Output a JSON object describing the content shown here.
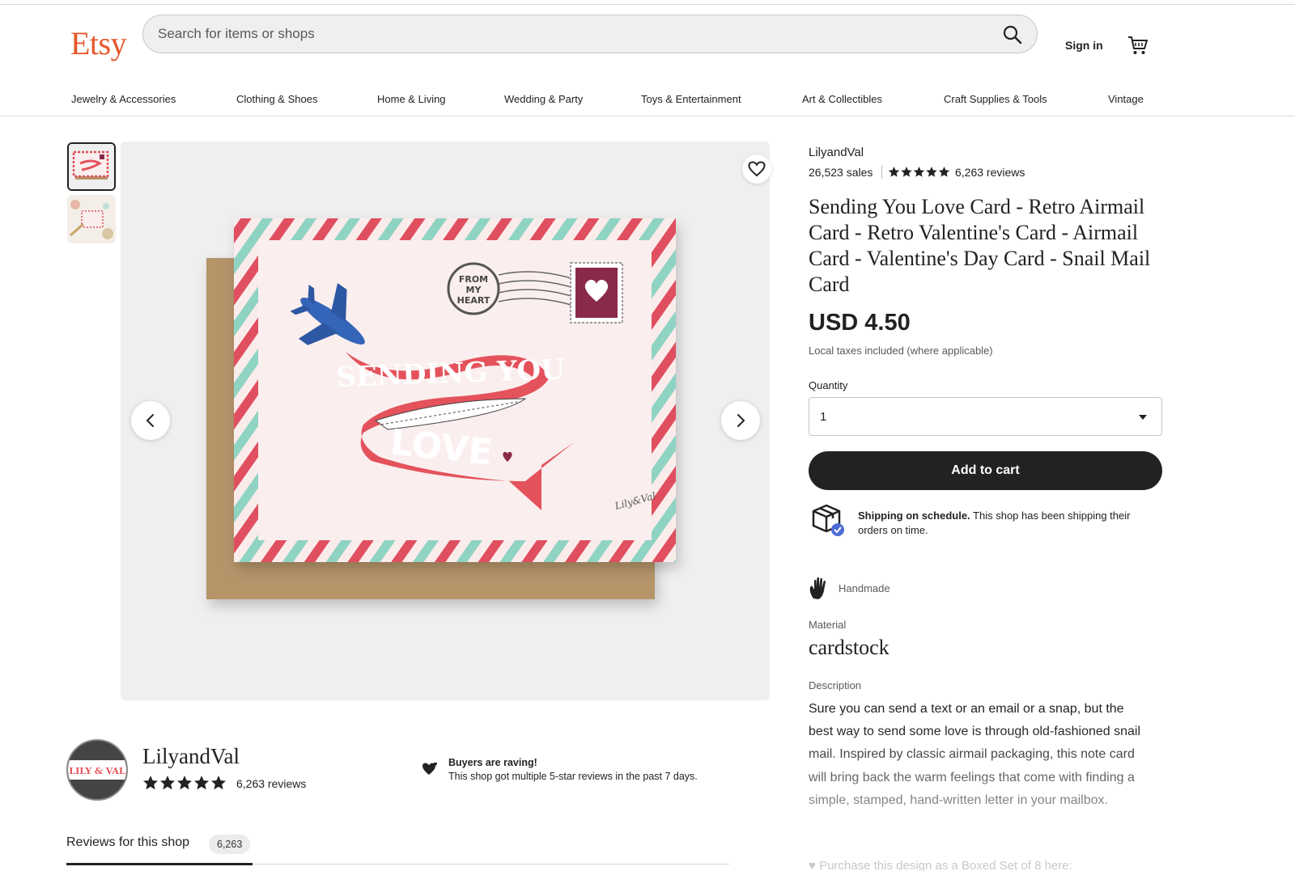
{
  "header": {
    "logo": "Etsy",
    "search_placeholder": "Search for items or shops",
    "sign_in": "Sign in"
  },
  "categories": [
    "Jewelry & Accessories",
    "Clothing & Shoes",
    "Home & Living",
    "Wedding & Party",
    "Toys & Entertainment",
    "Art & Collectibles",
    "Craft Supplies & Tools",
    "Vintage"
  ],
  "gallery": {
    "card_text_top": "SENDING YOU",
    "card_text_bottom": "LOVE",
    "stamp_text": [
      "FROM",
      "MY",
      "HEART"
    ],
    "signature": "Lily&Val"
  },
  "listing": {
    "seller": "LilyandVal",
    "sales": "26,523 sales",
    "rating_stars": 5,
    "reviews": "6,263 reviews",
    "title": "Sending You Love Card - Retro Airmail Card - Retro Valentine's Card - Airmail Card - Valentine's Day Card - Snail Mail Card",
    "price": "USD 4.50",
    "tax_note": "Local taxes included (where applicable)",
    "quantity_label": "Quantity",
    "quantity_value": "1",
    "add_to_cart": "Add to cart",
    "shipping_bold": "Shipping on schedule.",
    "shipping_text": " This shop has been shipping their orders on time.",
    "handmade": "Handmade",
    "material_label": "Material",
    "material_value": "cardstock",
    "description_label": "Description",
    "description": "Sure you can send a text or an email or a snap, but the best way to send some love is through old-fashioned snail mail. Inspired by classic airmail packaging, this note card will bring back the warm feelings that come with finding a simple, stamped, hand-written letter in your mailbox.",
    "description_more": "♥ Purchase this design as a Boxed Set of 8 here:"
  },
  "shop": {
    "name": "LilyandVal",
    "logo_text": "LILY & VAL",
    "rating_stars": 5,
    "reviews": "6,263 reviews",
    "raving_title": "Buyers are raving!",
    "raving_text": "This shop got multiple 5-star reviews in the past 7 days.",
    "reviews_tab": "Reviews for this shop",
    "reviews_count": "6,263"
  },
  "colors": {
    "brand": "#e5572a",
    "stripe_red": "#e0505f",
    "stripe_mint": "#8fd3c3",
    "banner_red": "#e4525c",
    "plane_blue": "#3465b8",
    "stamp_maroon": "#8a2a4a"
  }
}
